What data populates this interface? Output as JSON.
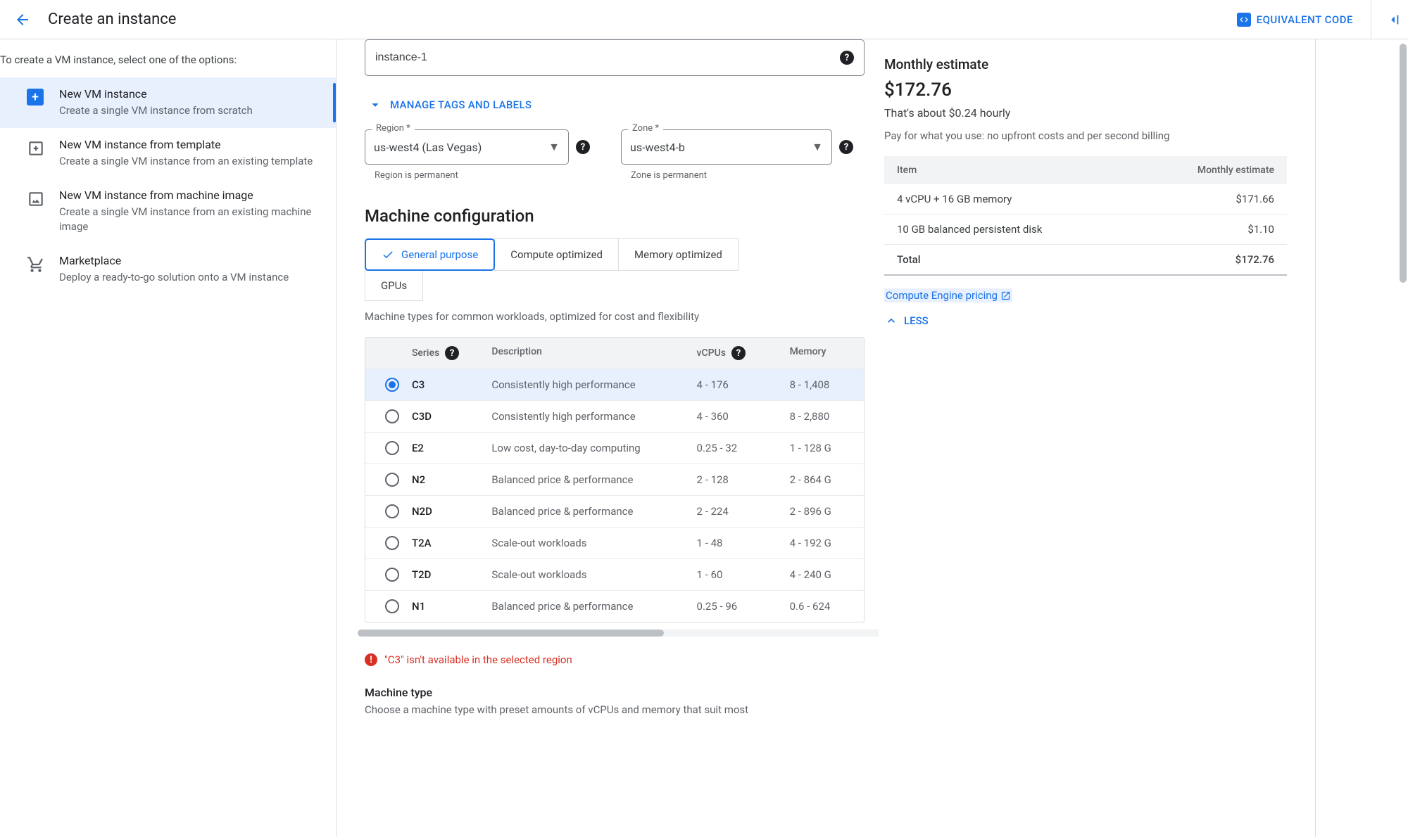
{
  "header": {
    "title": "Create an instance",
    "equivalent_code": "EQUIVALENT CODE"
  },
  "sidebar": {
    "intro": "To create a VM instance, select one of the options:",
    "items": [
      {
        "title": "New VM instance",
        "desc": "Create a single VM instance from scratch"
      },
      {
        "title": "New VM instance from template",
        "desc": "Create a single VM instance from an existing template"
      },
      {
        "title": "New VM instance from machine image",
        "desc": "Create a single VM instance from an existing machine image"
      },
      {
        "title": "Marketplace",
        "desc": "Deploy a ready-to-go solution onto a VM instance"
      }
    ]
  },
  "form": {
    "name_value": "instance-1",
    "manage_tags": "MANAGE TAGS AND LABELS",
    "region": {
      "label": "Region *",
      "value": "us-west4 (Las Vegas)",
      "hint": "Region is permanent"
    },
    "zone": {
      "label": "Zone *",
      "value": "us-west4-b",
      "hint": "Zone is permanent"
    },
    "machine_config_title": "Machine configuration",
    "tabs": [
      "General purpose",
      "Compute optimized",
      "Memory optimized",
      "GPUs"
    ],
    "tab_desc": "Machine types for common workloads, optimized for cost and flexibility",
    "series_cols": {
      "series": "Series",
      "desc": "Description",
      "vcpu": "vCPUs",
      "mem": "Memory"
    },
    "series": [
      {
        "name": "C3",
        "desc": "Consistently high performance",
        "vcpu": "4 - 176",
        "mem": "8 - 1,408"
      },
      {
        "name": "C3D",
        "desc": "Consistently high performance",
        "vcpu": "4 - 360",
        "mem": "8 - 2,880"
      },
      {
        "name": "E2",
        "desc": "Low cost, day-to-day computing",
        "vcpu": "0.25 - 32",
        "mem": "1 - 128 G"
      },
      {
        "name": "N2",
        "desc": "Balanced price & performance",
        "vcpu": "2 - 128",
        "mem": "2 - 864 G"
      },
      {
        "name": "N2D",
        "desc": "Balanced price & performance",
        "vcpu": "2 - 224",
        "mem": "2 - 896 G"
      },
      {
        "name": "T2A",
        "desc": "Scale-out workloads",
        "vcpu": "1 - 48",
        "mem": "4 - 192 G"
      },
      {
        "name": "T2D",
        "desc": "Scale-out workloads",
        "vcpu": "1 - 60",
        "mem": "4 - 240 G"
      },
      {
        "name": "N1",
        "desc": "Balanced price & performance",
        "vcpu": "0.25 - 96",
        "mem": "0.6 - 624"
      }
    ],
    "error": "\"C3\" isn't available in the selected region",
    "machine_type_title": "Machine type",
    "machine_type_desc": "Choose a machine type with preset amounts of vCPUs and memory that suit most"
  },
  "estimate": {
    "title": "Monthly estimate",
    "price": "$172.76",
    "hourly": "That's about $0.24 hourly",
    "note": "Pay for what you use: no upfront costs and per second billing",
    "cols": {
      "item": "Item",
      "est": "Monthly estimate"
    },
    "rows": [
      {
        "item": "4 vCPU + 16 GB memory",
        "est": "$171.66"
      },
      {
        "item": "10 GB balanced persistent disk",
        "est": "$1.10"
      }
    ],
    "total": {
      "item": "Total",
      "est": "$172.76"
    },
    "pricing_link": "Compute Engine pricing",
    "less": "LESS"
  }
}
